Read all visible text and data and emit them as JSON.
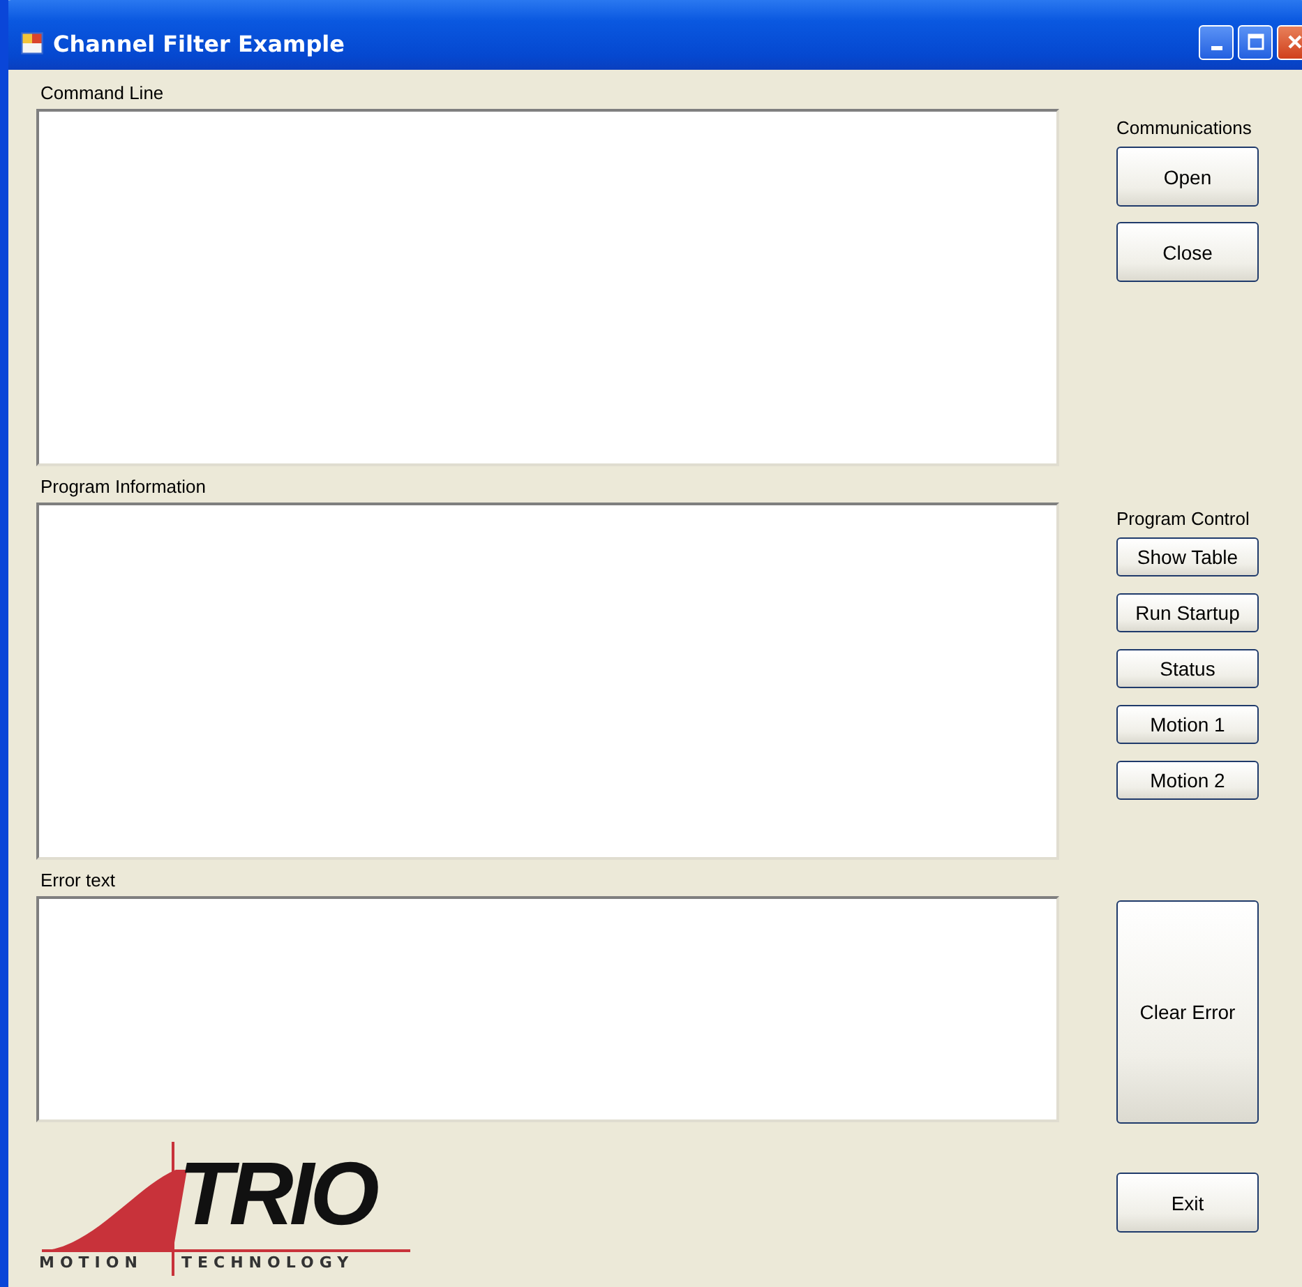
{
  "window": {
    "title": "Channel Filter Example"
  },
  "panes": [
    {
      "label": "Command Line"
    },
    {
      "label": "Program Information"
    },
    {
      "label": "Error text"
    }
  ],
  "communications": {
    "title": "Communications",
    "buttons": [
      "Open",
      "Close"
    ]
  },
  "program_control": {
    "title": "Program Control",
    "buttons": [
      "Show Table",
      "Run Startup",
      "Status",
      "Motion 1",
      "Motion 2"
    ]
  },
  "clear_error_button": "Clear Error",
  "exit_button": "Exit",
  "logo": {
    "name": "TRIO",
    "tagline_left": "MOTION",
    "tagline_right": "TECHNOLOGY"
  }
}
